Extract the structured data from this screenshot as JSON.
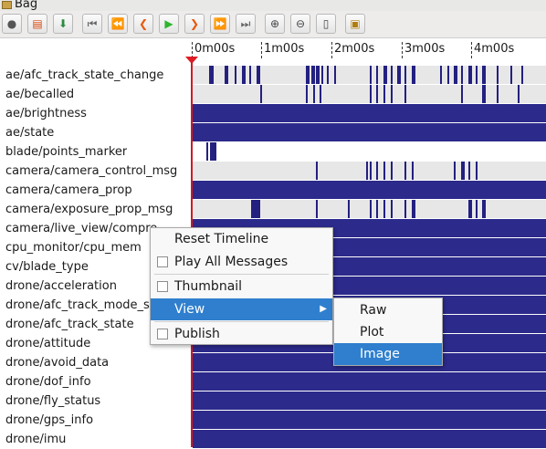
{
  "window": {
    "title": "Bag"
  },
  "toolbar": {
    "buttons": [
      {
        "name": "record-button",
        "glyph": "●",
        "color": "#555555"
      },
      {
        "name": "open-bag-button",
        "glyph": "▤",
        "color": "#d9480f"
      },
      {
        "name": "save-bag-button",
        "glyph": "⬇",
        "color": "#2b8a3e"
      },
      {
        "name": "go-to-start-button",
        "glyph": "⏮",
        "color": "#666666"
      },
      {
        "name": "rewind-button",
        "glyph": "⏪",
        "color": "#666666"
      },
      {
        "name": "step-back-button",
        "glyph": "❮",
        "color": "#e8590c"
      },
      {
        "name": "play-button",
        "glyph": "▶",
        "color": "#2fb52f"
      },
      {
        "name": "step-forward-button",
        "glyph": "❯",
        "color": "#e8590c"
      },
      {
        "name": "fast-forward-button",
        "glyph": "⏩",
        "color": "#666666"
      },
      {
        "name": "go-to-end-button",
        "glyph": "⏭",
        "color": "#666666"
      },
      {
        "name": "zoom-in-button",
        "glyph": "⊕",
        "color": "#444444"
      },
      {
        "name": "zoom-out-button",
        "glyph": "⊖",
        "color": "#444444"
      },
      {
        "name": "zoom-reset-button",
        "glyph": "▯",
        "color": "#444444"
      },
      {
        "name": "thumbnail-toggle-button",
        "glyph": "▣",
        "color": "#b07d10"
      }
    ]
  },
  "timeline": {
    "ticks": [
      "0m00s",
      "1m00s",
      "2m00s",
      "3m00s",
      "4m00s"
    ],
    "bar_color": "#2c2a8b",
    "mark_color": "#232080",
    "playhead_color": "#e01b24"
  },
  "topics": [
    {
      "name": "ae/afc_track_state_change",
      "style": "sparse",
      "marks": [
        [
          0.046,
          0.06
        ],
        [
          0.09,
          0.1
        ],
        [
          0.12,
          0.125
        ],
        [
          0.14,
          0.15
        ],
        [
          0.16,
          0.165
        ],
        [
          0.18,
          0.19
        ],
        [
          0.32,
          0.33
        ],
        [
          0.335,
          0.345
        ],
        [
          0.35,
          0.36
        ],
        [
          0.365,
          0.37
        ],
        [
          0.38,
          0.385
        ],
        [
          0.4,
          0.405
        ],
        [
          0.5,
          0.505
        ],
        [
          0.52,
          0.525
        ],
        [
          0.54,
          0.55
        ],
        [
          0.56,
          0.565
        ],
        [
          0.58,
          0.59
        ],
        [
          0.6,
          0.605
        ],
        [
          0.62,
          0.63
        ],
        [
          0.7,
          0.705
        ],
        [
          0.72,
          0.725
        ],
        [
          0.74,
          0.75
        ],
        [
          0.76,
          0.765
        ],
        [
          0.78,
          0.79
        ],
        [
          0.8,
          0.805
        ],
        [
          0.82,
          0.83
        ],
        [
          0.86,
          0.865
        ],
        [
          0.9,
          0.905
        ],
        [
          0.93,
          0.935
        ]
      ]
    },
    {
      "name": "ae/becalled",
      "style": "sparse",
      "marks": [
        [
          0.19,
          0.195
        ],
        [
          0.32,
          0.325
        ],
        [
          0.34,
          0.345
        ],
        [
          0.36,
          0.365
        ],
        [
          0.5,
          0.505
        ],
        [
          0.52,
          0.525
        ],
        [
          0.54,
          0.545
        ],
        [
          0.56,
          0.565
        ],
        [
          0.6,
          0.605
        ],
        [
          0.76,
          0.765
        ],
        [
          0.82,
          0.83
        ],
        [
          0.86,
          0.865
        ],
        [
          0.92,
          0.925
        ]
      ]
    },
    {
      "name": "ae/brightness",
      "style": "full",
      "marks": []
    },
    {
      "name": "ae/state",
      "style": "full",
      "marks": []
    },
    {
      "name": "blade/points_marker",
      "style": "blade",
      "marks": [
        [
          0.04,
          0.045
        ],
        [
          0.048,
          0.065
        ]
      ]
    },
    {
      "name": "camera/camera_control_msg",
      "style": "sparse",
      "marks": [
        [
          0.35,
          0.355
        ],
        [
          0.49,
          0.495
        ],
        [
          0.5,
          0.505
        ],
        [
          0.52,
          0.525
        ],
        [
          0.54,
          0.545
        ],
        [
          0.56,
          0.565
        ],
        [
          0.6,
          0.605
        ],
        [
          0.62,
          0.625
        ],
        [
          0.74,
          0.745
        ],
        [
          0.76,
          0.77
        ],
        [
          0.78,
          0.785
        ],
        [
          0.8,
          0.805
        ]
      ]
    },
    {
      "name": "camera/camera_prop",
      "style": "full",
      "marks": []
    },
    {
      "name": "camera/exposure_prop_msg",
      "style": "sparse",
      "marks": [
        [
          0.165,
          0.19
        ],
        [
          0.35,
          0.355
        ],
        [
          0.44,
          0.445
        ],
        [
          0.5,
          0.505
        ],
        [
          0.52,
          0.525
        ],
        [
          0.54,
          0.545
        ],
        [
          0.56,
          0.565
        ],
        [
          0.6,
          0.605
        ],
        [
          0.62,
          0.63
        ],
        [
          0.78,
          0.79
        ],
        [
          0.8,
          0.805
        ],
        [
          0.82,
          0.83
        ]
      ]
    },
    {
      "name": "camera/live_view/compre",
      "style": "full",
      "marks": []
    },
    {
      "name": "cpu_monitor/cpu_mem",
      "style": "full",
      "marks": []
    },
    {
      "name": "cv/blade_type",
      "style": "full",
      "marks": []
    },
    {
      "name": "drone/acceleration",
      "style": "full",
      "marks": []
    },
    {
      "name": "drone/afc_track_mode_st",
      "style": "full",
      "marks": []
    },
    {
      "name": "drone/afc_track_state",
      "style": "full",
      "marks": []
    },
    {
      "name": "drone/attitude",
      "style": "full",
      "marks": []
    },
    {
      "name": "drone/avoid_data",
      "style": "full",
      "marks": []
    },
    {
      "name": "drone/dof_info",
      "style": "full",
      "marks": []
    },
    {
      "name": "drone/fly_status",
      "style": "full",
      "marks": []
    },
    {
      "name": "drone/gps_info",
      "style": "full",
      "marks": []
    },
    {
      "name": "drone/imu",
      "style": "full",
      "marks": []
    }
  ],
  "context_menu": {
    "reset_timeline": "Reset Timeline",
    "play_all_messages": "Play All Messages",
    "thumbnail": "Thumbnail",
    "view": "View",
    "publish": "Publish"
  },
  "submenu": {
    "raw": "Raw",
    "plot": "Plot",
    "image": "Image"
  }
}
